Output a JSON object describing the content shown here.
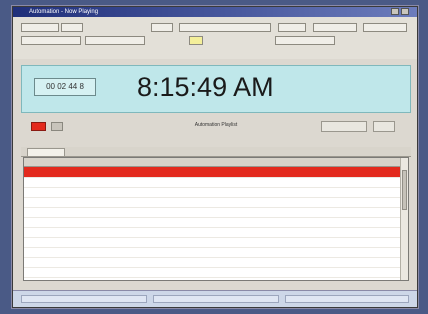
{
  "window": {
    "title": "Automation - Now Playing"
  },
  "toolbar": {
    "top_buttons": [
      "",
      "",
      "",
      "",
      "",
      "",
      ""
    ],
    "row2_buttons": [
      "",
      "",
      "",
      ""
    ]
  },
  "clock": {
    "counter": "00 02 44 8",
    "time": "8:15:49 AM"
  },
  "mid": {
    "title": "Automation Playlist",
    "right_button": ""
  },
  "tabs": [
    ""
  ],
  "table": {
    "headers": [
      "",
      "",
      "",
      "",
      "",
      "",
      ""
    ],
    "rows": [
      [
        "",
        "",
        "",
        "",
        "",
        "",
        ""
      ],
      [
        "",
        "",
        "",
        "",
        "",
        "",
        ""
      ],
      [
        "",
        "",
        "",
        "",
        "",
        "",
        ""
      ],
      [
        "",
        "",
        "",
        "",
        "",
        "",
        ""
      ],
      [
        "",
        "",
        "",
        "",
        "",
        "",
        ""
      ],
      [
        "",
        "",
        "",
        "",
        "",
        "",
        ""
      ],
      [
        "",
        "",
        "",
        "",
        "",
        "",
        ""
      ],
      [
        "",
        "",
        "",
        "",
        "",
        "",
        ""
      ],
      [
        "",
        "",
        "",
        "",
        "",
        "",
        ""
      ],
      [
        "",
        "",
        "",
        "",
        "",
        "",
        ""
      ],
      [
        "",
        "",
        "",
        "",
        "",
        "",
        ""
      ]
    ],
    "selected_row": 0
  },
  "status": {
    "segments": [
      "",
      "",
      ""
    ]
  },
  "colors": {
    "selected_row": "#e32a1d",
    "clock_bar": "#bfe7ea",
    "titlebar_start": "#1f2f7a"
  }
}
